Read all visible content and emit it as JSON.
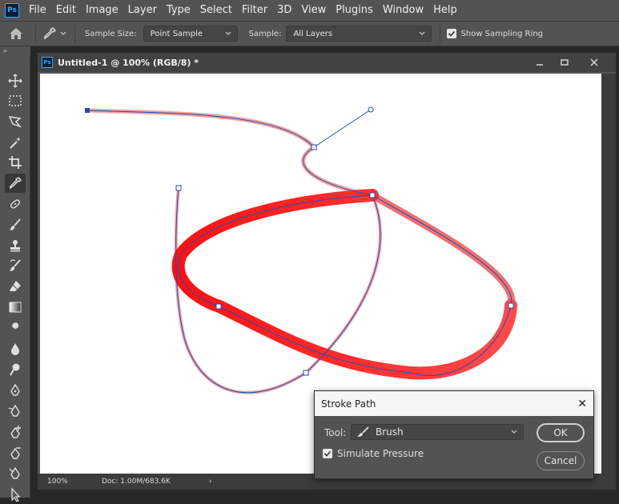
{
  "app": {
    "logo": "Ps"
  },
  "menu": [
    "File",
    "Edit",
    "Image",
    "Layer",
    "Type",
    "Select",
    "Filter",
    "3D",
    "View",
    "Plugins",
    "Window",
    "Help"
  ],
  "options": {
    "sample_size_label": "Sample Size:",
    "sample_size_value": "Point Sample",
    "sample_label": "Sample:",
    "sample_value": "All Layers",
    "show_sampling_ring_label": "Show Sampling Ring",
    "show_sampling_ring_checked": true
  },
  "tools_header": "»",
  "tools": [
    {
      "name": "move-tool",
      "icon": "move-icon"
    },
    {
      "name": "marquee-tool",
      "icon": "rect-marquee-icon"
    },
    {
      "name": "lasso-tool",
      "icon": "polygonal-lasso-icon"
    },
    {
      "name": "magic-wand-tool",
      "icon": "magic-wand-icon"
    },
    {
      "name": "crop-tool",
      "icon": "crop-icon"
    },
    {
      "name": "eyedropper-tool",
      "icon": "eyedropper-icon",
      "active": true
    },
    {
      "name": "healing-brush-tool",
      "icon": "bandage-icon"
    },
    {
      "name": "brush-tool",
      "icon": "brush-icon"
    },
    {
      "name": "clone-stamp-tool",
      "icon": "stamp-icon"
    },
    {
      "name": "history-brush-tool",
      "icon": "history-brush-icon"
    },
    {
      "name": "eraser-tool",
      "icon": "eraser-icon"
    },
    {
      "name": "gradient-tool",
      "icon": "gradient-icon"
    },
    {
      "name": "smudge-tool",
      "icon": "smudge-icon"
    },
    {
      "name": "blur-tool",
      "icon": "drop-icon"
    },
    {
      "name": "dodge-tool",
      "icon": "dodge-icon"
    },
    {
      "name": "pen-tool",
      "icon": "pen-icon"
    },
    {
      "name": "freeform-pen-tool",
      "icon": "freeform-pen-icon"
    },
    {
      "name": "add-anchor-tool",
      "icon": "add-anchor-pen-icon"
    },
    {
      "name": "delete-anchor-tool",
      "icon": "delete-anchor-pen-icon"
    },
    {
      "name": "convert-point-tool",
      "icon": "convert-point-icon"
    },
    {
      "name": "path-selection-tool",
      "icon": "arrow-icon"
    }
  ],
  "document": {
    "title": "Untitled-1 @ 100% (RGB/8) *",
    "icon": "Ps",
    "zoom": "100%",
    "doc_size": "Doc: 1.00M/683.6K",
    "status_arrow": "›"
  },
  "colors": {
    "stroke_red": "#ff1a1a",
    "stroke_soft": "#f08a8a",
    "path_blue": "#1f4fb5",
    "anchor_fill": "#ffffff"
  },
  "dialog": {
    "title": "Stroke Path",
    "close": "✕",
    "tool_label": "Tool:",
    "tool_value": "Brush",
    "simulate_pressure_label": "Simulate Pressure",
    "simulate_pressure_checked": true,
    "ok_label": "OK",
    "cancel_label": "Cancel"
  }
}
